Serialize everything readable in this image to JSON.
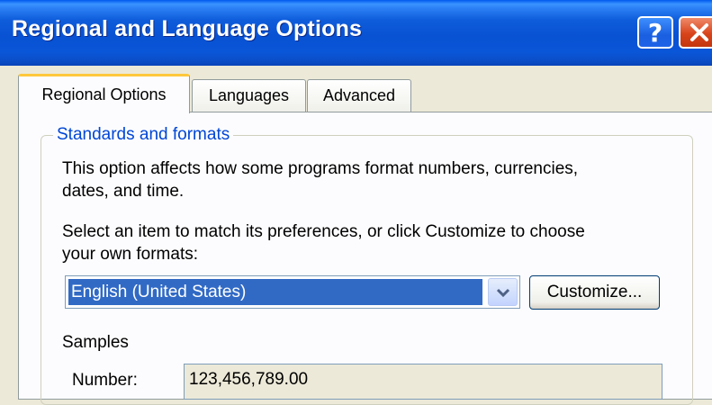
{
  "window": {
    "title": "Regional and Language Options",
    "help_label": "?",
    "colors": {
      "titlebar": "#0A56D8",
      "close": "#D8431B",
      "selection": "#316AC5",
      "group_label": "#0046D5"
    }
  },
  "tabs": [
    {
      "label": "Regional Options",
      "active": true
    },
    {
      "label": "Languages",
      "active": false
    },
    {
      "label": "Advanced",
      "active": false
    }
  ],
  "standards": {
    "group_label": "Standards and formats",
    "description_line1": "This option affects how some programs format numbers, currencies,",
    "description_line2": "dates, and time.",
    "instruction_line1": "Select an item to match its preferences, or click Customize to choose",
    "instruction_line2": "your own formats:",
    "selected_locale": "English (United States)",
    "customize_label": "Customize...",
    "samples_label": "Samples",
    "number_label": "Number:",
    "number_value": "123,456,789.00"
  }
}
